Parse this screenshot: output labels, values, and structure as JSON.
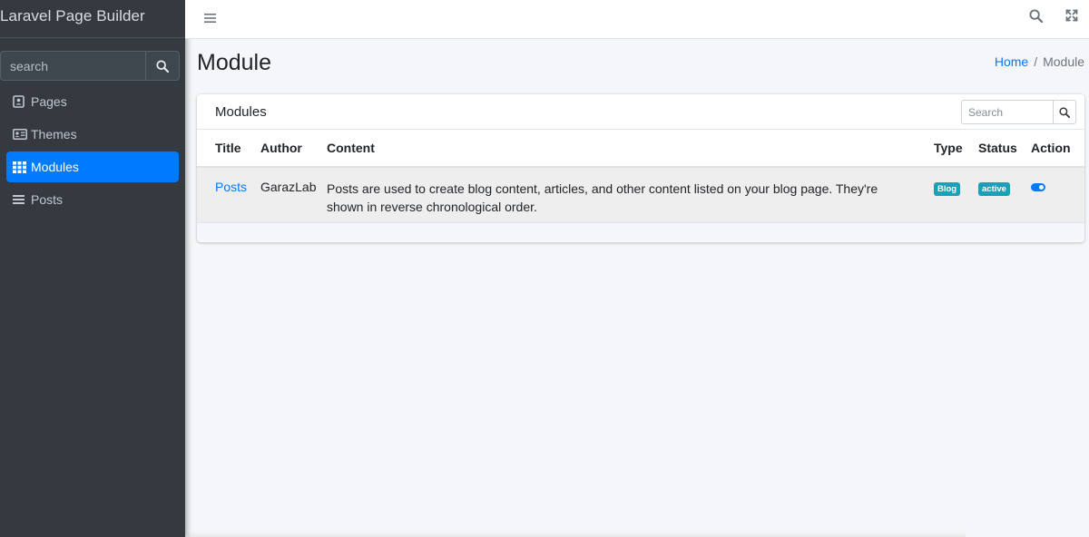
{
  "app": {
    "brand": "Laravel Page Builder"
  },
  "sidebar": {
    "search_placeholder": "search",
    "items": [
      {
        "label": "Pages",
        "icon": "file-person-icon"
      },
      {
        "label": "Themes",
        "icon": "id-card-icon"
      },
      {
        "label": "Modules",
        "icon": "grid-icon",
        "active": true
      },
      {
        "label": "Posts",
        "icon": "list-icon"
      }
    ]
  },
  "navbar": {
    "icons": [
      "hamburger-icon",
      "search-icon",
      "expand-icon"
    ]
  },
  "header": {
    "title": "Module",
    "breadcrumb": {
      "home": "Home",
      "separator": "/",
      "current": "Module"
    }
  },
  "card": {
    "title": "Modules",
    "search_placeholder": "Search",
    "columns": [
      "Title",
      "Author",
      "Content",
      "Type",
      "Status",
      "Action"
    ],
    "rows": [
      {
        "title": "Posts",
        "author": "GarazLab",
        "content": "Posts are used to create blog content, articles, and other content listed on your blog page. They're shown in reverse chronological order.",
        "type": "Blog",
        "status": "active",
        "action_enabled": true
      }
    ]
  },
  "colors": {
    "primary": "#007bff",
    "sidebar_bg": "#343a40",
    "badge": "#17a2b8",
    "page_bg": "#f4f6f9"
  }
}
